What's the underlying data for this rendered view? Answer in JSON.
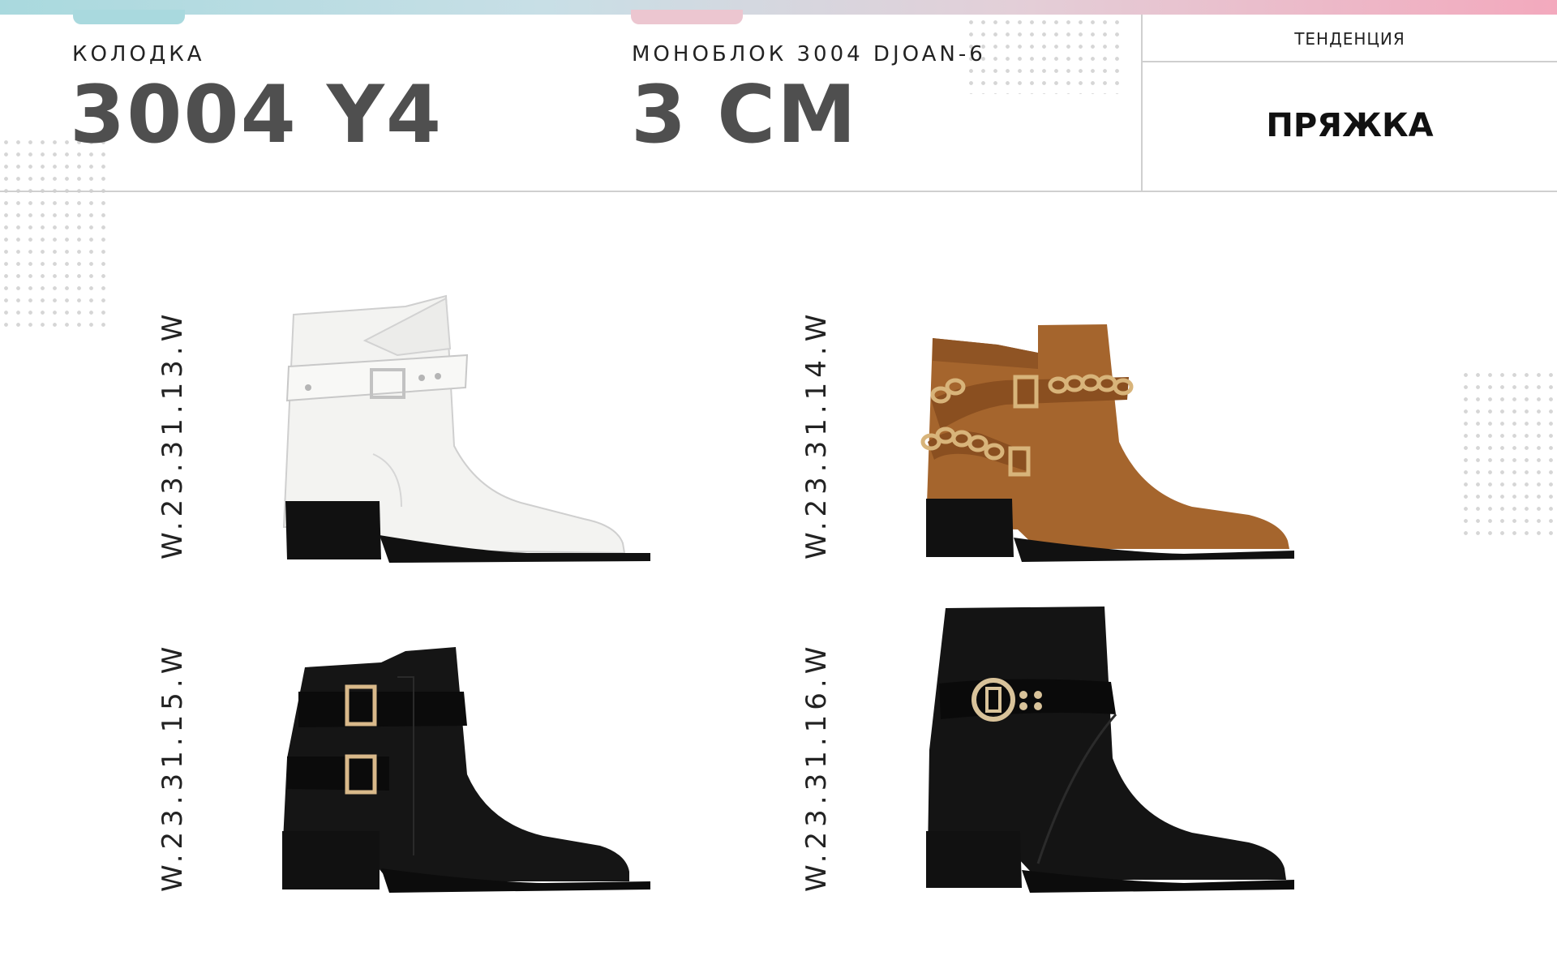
{
  "header": {
    "last_label": "КОЛОДКА",
    "last_value": "3004 Y4",
    "monoblock_label": "МОНОБЛОК 3004 DJOAN-6",
    "monoblock_value": "3 СМ",
    "trend_label": "ТЕНДЕНЦИЯ",
    "trend_value": "ПРЯЖКА"
  },
  "products": [
    {
      "code": "W.23.31.13.W",
      "image": "white-buckle-ankle-boot",
      "color": "#f2f2f0"
    },
    {
      "code": "W.23.31.14.W",
      "image": "tan-suede-chain-boot",
      "color": "#a8682f"
    },
    {
      "code": "W.23.31.15.W",
      "image": "black-double-buckle-boot",
      "color": "#151515"
    },
    {
      "code": "W.23.31.16.W",
      "image": "black-ring-buckle-boot",
      "color": "#151515"
    }
  ]
}
